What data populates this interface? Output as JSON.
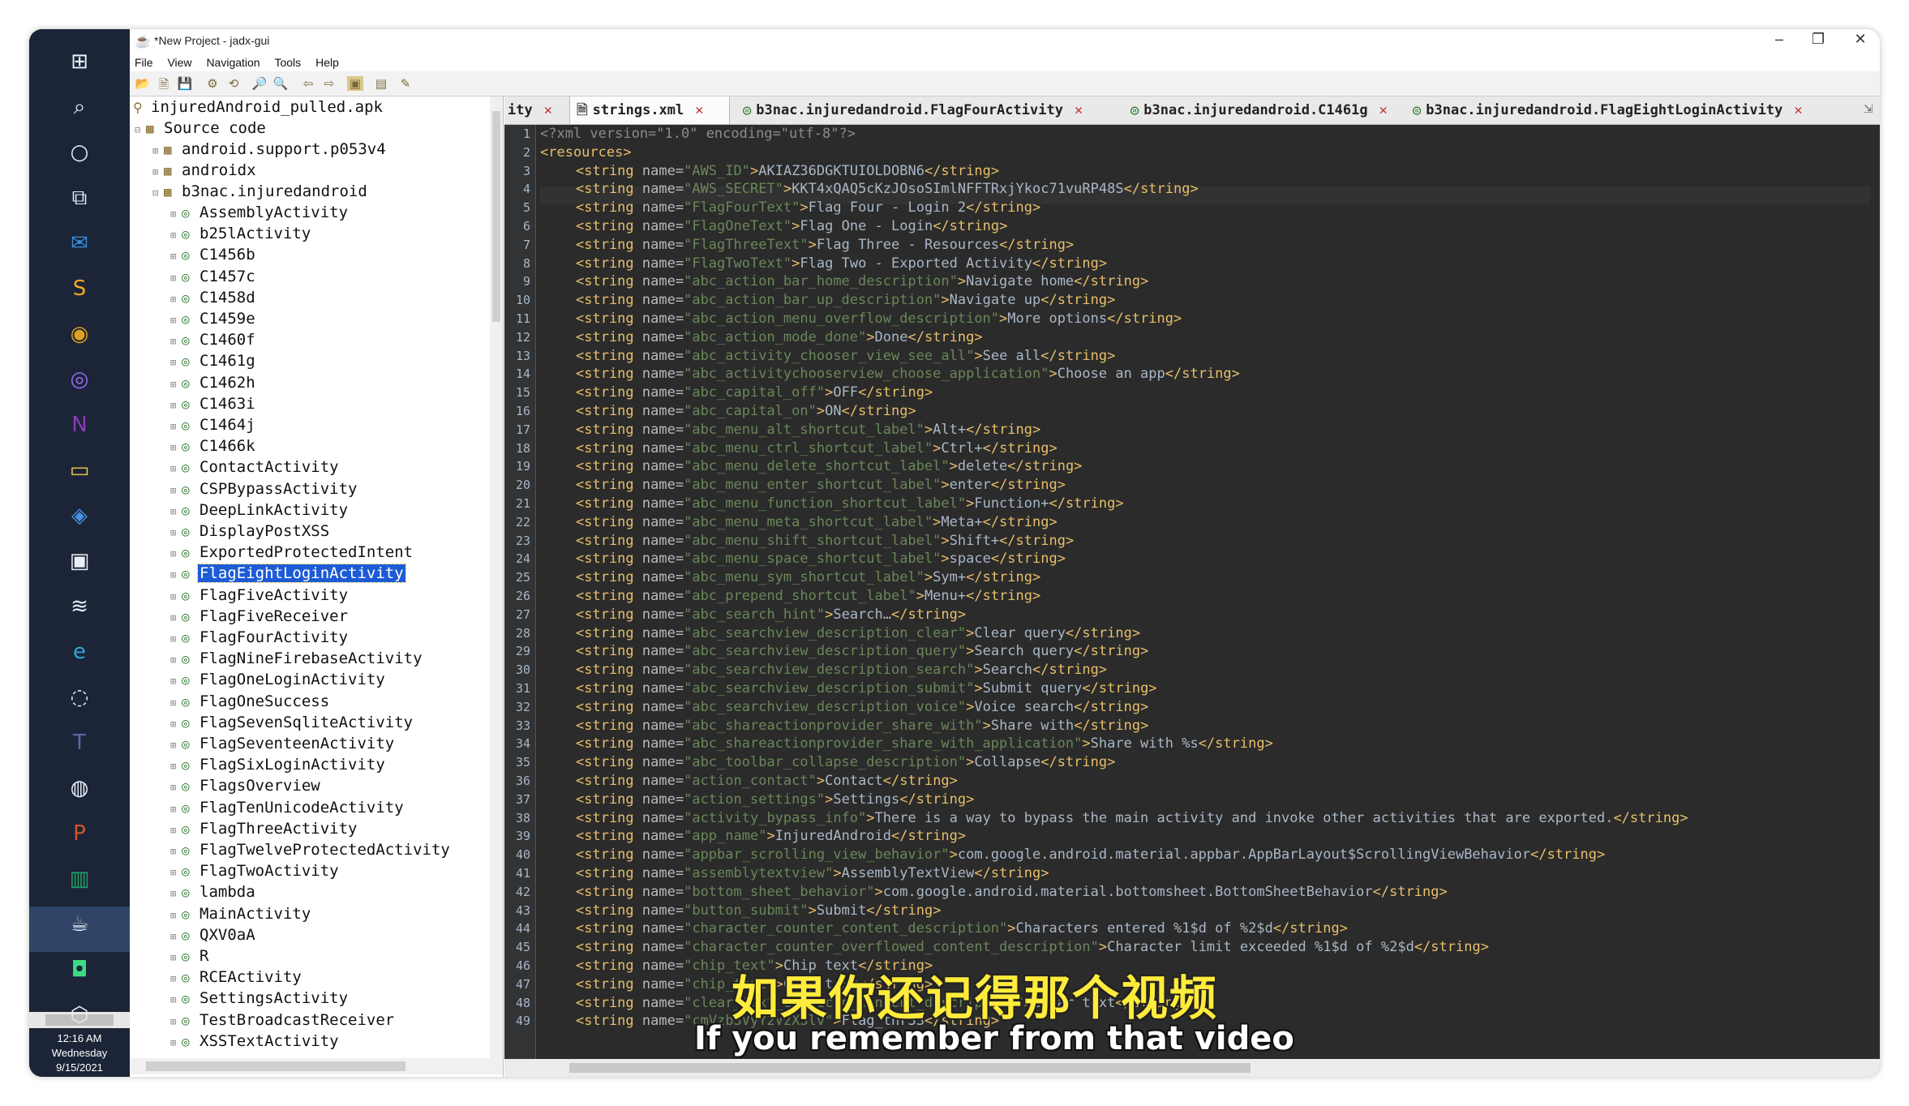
{
  "window": {
    "title": "*New Project - jadx-gui",
    "minimize": "–",
    "restore": "❐",
    "close": "✕"
  },
  "menu": [
    "File",
    "View",
    "Navigation",
    "Tools",
    "Help"
  ],
  "taskbar": {
    "icons": [
      "start-icon",
      "search-icon",
      "cortana-icon",
      "task-view-icon",
      "mail-icon",
      "sublime-icon",
      "chrome-icon",
      "media-icon",
      "onenote-icon",
      "explorer-icon",
      "app-icon",
      "store-icon",
      "stack-icon",
      "edge-icon",
      "chat-icon",
      "teams-icon",
      "obs-icon",
      "powerpoint-icon",
      "sheets-icon",
      "jadx-icon",
      "android-icon",
      "box-icon"
    ],
    "clock": {
      "time": "12:16 AM",
      "day": "Wednesday",
      "date": "9/15/2021"
    }
  },
  "tree": {
    "root": "injuredAndroid_pulled.apk",
    "source": "Source code",
    "packages": [
      "android.support.p053v4",
      "androidx",
      "b3nac.injuredandroid"
    ],
    "classes": [
      "AssemblyActivity",
      "b25lActivity",
      "C1456b",
      "C1457c",
      "C1458d",
      "C1459e",
      "C1460f",
      "C1461g",
      "C1462h",
      "C1463i",
      "C1464j",
      "C1466k",
      "ContactActivity",
      "CSPBypassActivity",
      "DeepLinkActivity",
      "DisplayPostXSS",
      "ExportedProtectedIntent",
      "FlagEightLoginActivity",
      "FlagFiveActivity",
      "FlagFiveReceiver",
      "FlagFourActivity",
      "FlagNineFirebaseActivity",
      "FlagOneLoginActivity",
      "FlagOneSuccess",
      "FlagSevenSqliteActivity",
      "FlagSeventeenActivity",
      "FlagSixLoginActivity",
      "FlagsOverview",
      "FlagTenUnicodeActivity",
      "FlagThreeActivity",
      "FlagTwelveProtectedActivity",
      "FlagTwoActivity",
      "lambda",
      "MainActivity",
      "QXV0aA",
      "R",
      "RCEActivity",
      "SettingsActivity",
      "TestBroadcastReceiver",
      "XSSTextActivity"
    ],
    "selected": "FlagEightLoginActivity"
  },
  "tabs": [
    {
      "label": "ity",
      "close": "✕"
    },
    {
      "label": "strings.xml",
      "close": "✕",
      "active": true
    },
    {
      "label": "b3nac.injuredandroid.FlagFourActivity",
      "close": "✕"
    },
    {
      "label": "b3nac.injuredandroid.C1461g",
      "close": "✕"
    },
    {
      "label": "b3nac.injuredandroid.FlagEightLoginActivity",
      "close": "✕"
    }
  ],
  "editor": {
    "header": "<?xml version=\"1.0\" encoding=\"utf-8\"?>",
    "resources_open": "<resources>",
    "strings": [
      [
        "AWS_ID",
        "AKIAZ36DGKTUIOLDOBN6"
      ],
      [
        "AWS_SECRET",
        "KKT4xQAQ5cKzJOsoSImlNFFTRxjYkoc71vuRP48S"
      ],
      [
        "FlagFourText",
        "Flag Four - Login 2"
      ],
      [
        "FlagOneText",
        "Flag One - Login"
      ],
      [
        "FlagThreeText",
        "Flag Three - Resources"
      ],
      [
        "FlagTwoText",
        "Flag Two - Exported Activity"
      ],
      [
        "abc_action_bar_home_description",
        "Navigate home"
      ],
      [
        "abc_action_bar_up_description",
        "Navigate up"
      ],
      [
        "abc_action_menu_overflow_description",
        "More options"
      ],
      [
        "abc_action_mode_done",
        "Done"
      ],
      [
        "abc_activity_chooser_view_see_all",
        "See all"
      ],
      [
        "abc_activitychooserview_choose_application",
        "Choose an app"
      ],
      [
        "abc_capital_off",
        "OFF"
      ],
      [
        "abc_capital_on",
        "ON"
      ],
      [
        "abc_menu_alt_shortcut_label",
        "Alt+"
      ],
      [
        "abc_menu_ctrl_shortcut_label",
        "Ctrl+"
      ],
      [
        "abc_menu_delete_shortcut_label",
        "delete"
      ],
      [
        "abc_menu_enter_shortcut_label",
        "enter"
      ],
      [
        "abc_menu_function_shortcut_label",
        "Function+"
      ],
      [
        "abc_menu_meta_shortcut_label",
        "Meta+"
      ],
      [
        "abc_menu_shift_shortcut_label",
        "Shift+"
      ],
      [
        "abc_menu_space_shortcut_label",
        "space"
      ],
      [
        "abc_menu_sym_shortcut_label",
        "Sym+"
      ],
      [
        "abc_prepend_shortcut_label",
        "Menu+"
      ],
      [
        "abc_search_hint",
        "Search…"
      ],
      [
        "abc_searchview_description_clear",
        "Clear query"
      ],
      [
        "abc_searchview_description_query",
        "Search query"
      ],
      [
        "abc_searchview_description_search",
        "Search"
      ],
      [
        "abc_searchview_description_submit",
        "Submit query"
      ],
      [
        "abc_searchview_description_voice",
        "Voice search"
      ],
      [
        "abc_shareactionprovider_share_with",
        "Share with"
      ],
      [
        "abc_shareactionprovider_share_with_application",
        "Share with %s"
      ],
      [
        "abc_toolbar_collapse_description",
        "Collapse"
      ],
      [
        "action_contact",
        "Contact"
      ],
      [
        "action_settings",
        "Settings"
      ],
      [
        "activity_bypass_info",
        "There is a way to bypass the main activity and invoke other activities that are exported."
      ],
      [
        "app_name",
        "InjuredAndroid"
      ],
      [
        "appbar_scrolling_view_behavior",
        "com.google.android.material.appbar.AppBarLayout$ScrollingViewBehavior"
      ],
      [
        "assemblytextview",
        "AssemblyTextView"
      ],
      [
        "bottom_sheet_behavior",
        "com.google.android.material.bottomsheet.BottomSheetBehavior"
      ],
      [
        "button_submit",
        "Submit"
      ],
      [
        "character_counter_content_description",
        "Characters entered %1$d of %2$d"
      ],
      [
        "character_counter_overflowed_content_description",
        "Character limit exceeded %1$d of %2$d"
      ],
      [
        "chip_text",
        "Chip text"
      ],
      [
        "chip_text",
        "Chip text"
      ],
      [
        "clear_text_end_icon_content_description",
        "Clear text"
      ],
      [
        "cmVzb3VyY2VzX3lv",
        "Flag_thr33"
      ]
    ]
  },
  "subtitle": {
    "chinese": "如果你还记得那个视频",
    "english": "If you remember from that video"
  }
}
